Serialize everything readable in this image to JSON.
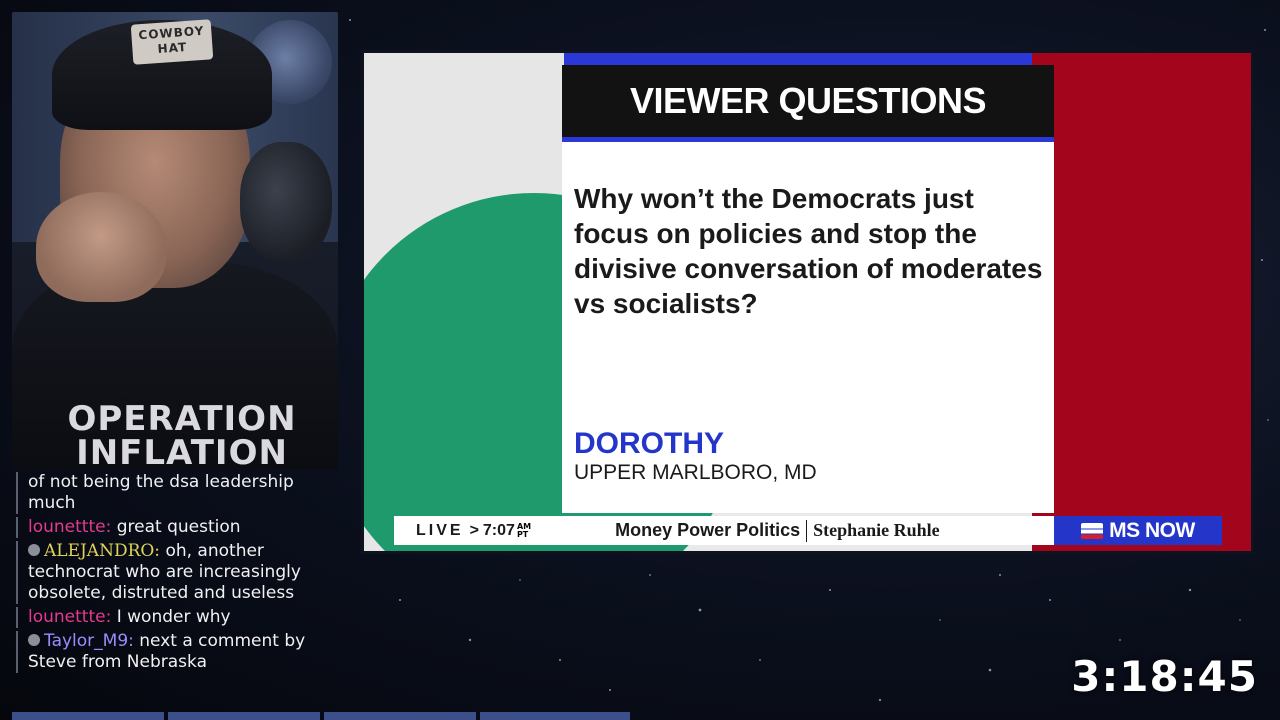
{
  "webcam": {
    "hat_text": "COWBOY\nHAT",
    "shirt_text": "OPERATION\nINFLATION"
  },
  "chat": {
    "messages": [
      {
        "user": "",
        "user_color": "#ffffff",
        "has_badge": false,
        "text": "of not being the dsa leadership much"
      },
      {
        "user": "lounettte:",
        "user_color": "#e23c8f",
        "has_badge": false,
        "text": "great question"
      },
      {
        "user": "ALEJANDRO:",
        "user_color": "#e0d35a",
        "has_badge": true,
        "text": "oh, another technocrat who are increasingly obsolete, distruted and useless"
      },
      {
        "user": "lounettte:",
        "user_color": "#e23c8f",
        "has_badge": false,
        "text": "I wonder why"
      },
      {
        "user": "Taylor_M9:",
        "user_color": "#9b8cff",
        "has_badge": true,
        "text": "next a comment by Steve from Nebraska"
      }
    ]
  },
  "stream_timer": "3:18:45",
  "broadcast": {
    "card_title": "VIEWER QUESTIONS",
    "question": "Why won’t the Democrats just focus on policies and stop the divisive conversation of moderates vs socialists?",
    "viewer_name": "DOROTHY",
    "viewer_location": "UPPER MARLBORO, MD",
    "ticker": {
      "live_label": "LIVE",
      "arrow": ">",
      "time": "7:07",
      "ampm_top": "AM",
      "ampm_bottom": "PT",
      "show_name": "Money Power Politics",
      "host": "Stephanie Ruhle",
      "network": "MS NOW"
    },
    "colors": {
      "accent_blue": "#2436c9",
      "accent_red": "#a3061c",
      "accent_green": "#1f9a6d"
    }
  }
}
